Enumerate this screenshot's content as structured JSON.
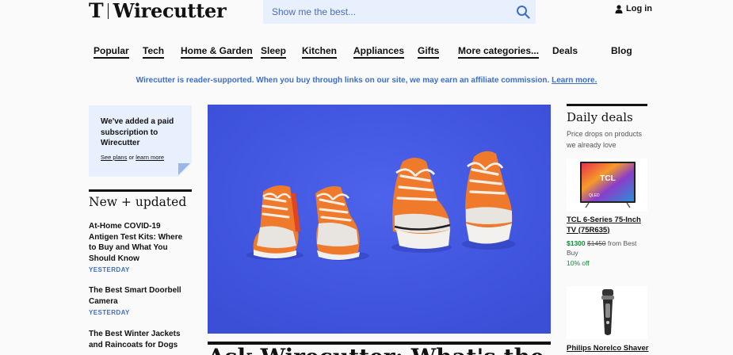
{
  "header": {
    "logo_mark": "T",
    "logo_text": "Wirecutter",
    "search_placeholder": "Show me the best...",
    "login_label": "Log in"
  },
  "nav": {
    "items": [
      {
        "label": "Popular"
      },
      {
        "label": "Tech"
      },
      {
        "label": "Home & Garden"
      },
      {
        "label": "Sleep"
      },
      {
        "label": "Kitchen"
      },
      {
        "label": "Appliances"
      },
      {
        "label": "Gifts"
      },
      {
        "label": "More categories..."
      },
      {
        "label": "Deals"
      },
      {
        "label": "Blog"
      }
    ]
  },
  "affiliate": {
    "text": "Wirecutter is reader-supported. When you buy through links on our site, we may earn an affiliate commission.",
    "link_label": "Learn more."
  },
  "promo": {
    "title": "We've added a paid subscription to Wirecutter",
    "plans_link": "See plans",
    "or_text": "or",
    "learn_link": "learn more"
  },
  "new_updated": {
    "heading": "New + updated",
    "articles": [
      {
        "title": "At-Home COVID-19 Antigen Test Kits: Where to Buy and What You Should Know",
        "time": "YESTERDAY"
      },
      {
        "title": "The Best Smart Doorbell Camera",
        "time": "YESTERDAY"
      },
      {
        "title": "The Best Winter Jackets and Raincoats for Dogs",
        "time": ""
      }
    ]
  },
  "hero": {
    "headline": "Ask Wirecutter: What's the Best"
  },
  "daily_deals": {
    "heading": "Daily deals",
    "subheading": "Price drops on products we already love",
    "items": [
      {
        "title": "TCL 6-Series 75-Inch TV (75R635)",
        "price_now": "$1300",
        "price_was": "$1450",
        "seller": "from Best Buy",
        "discount": "10% off",
        "image_brand": "TCL",
        "image_sub": "QLED"
      },
      {
        "title": "Philips Norelco Shaver"
      }
    ]
  },
  "colors": {
    "accent_blue": "#3d6ec9",
    "search_bg": "#e8f0fd",
    "hero_bg": "#4459e2",
    "deal_green": "#138a36",
    "shoe_orange": "#f07a2c"
  }
}
